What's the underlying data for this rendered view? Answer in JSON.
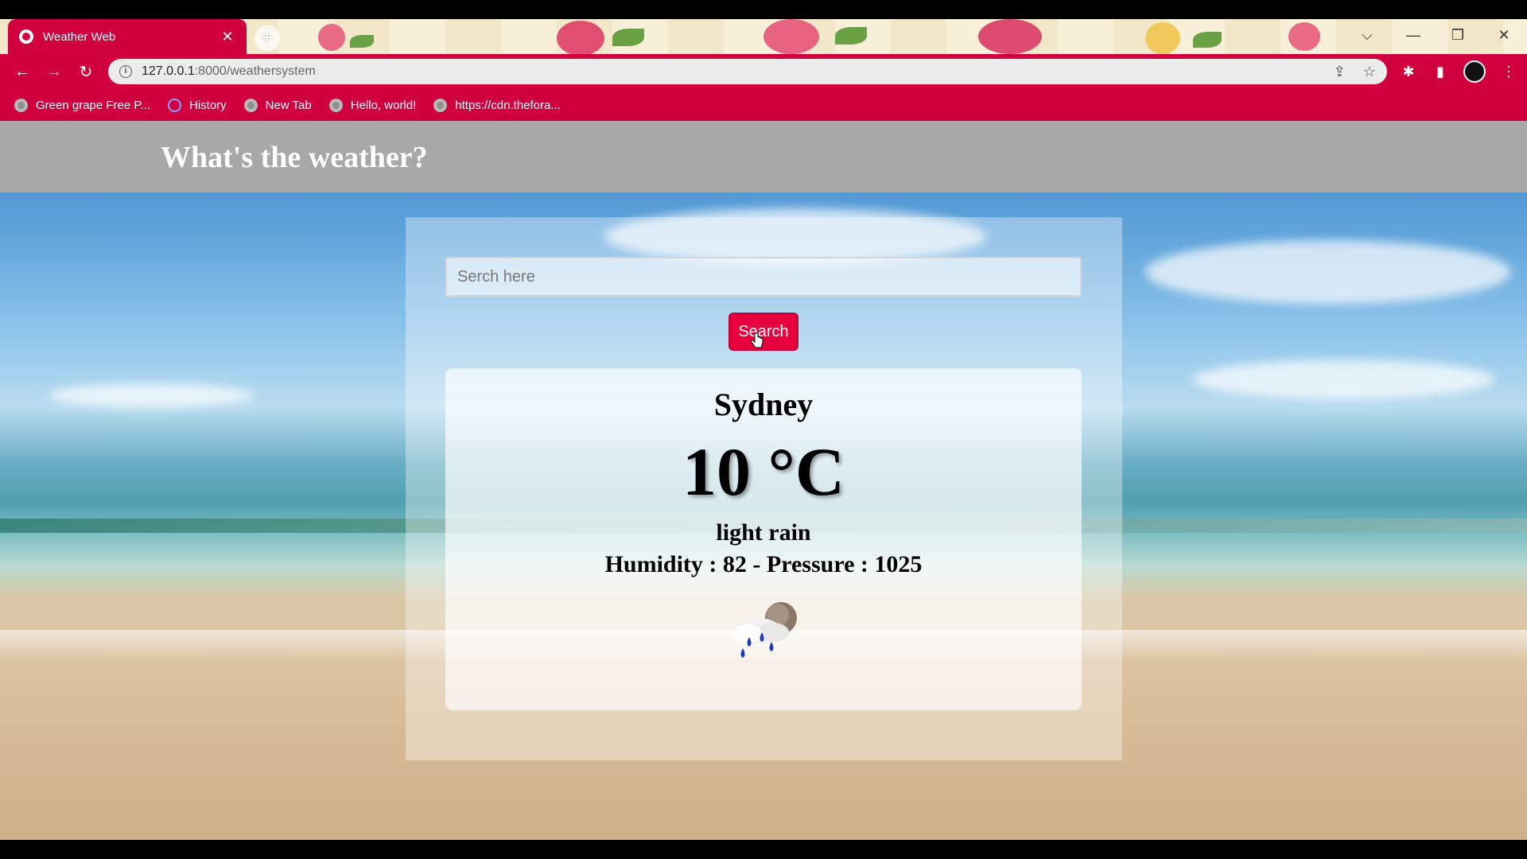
{
  "browser": {
    "tab_title": "Weather Web",
    "tab_close": "✕",
    "new_tab": "+",
    "url_host": "127.0.0.1",
    "url_path": ":8000/weathersystem",
    "bookmarks": [
      {
        "label": "Green grape Free P..."
      },
      {
        "label": "History"
      },
      {
        "label": "New Tab"
      },
      {
        "label": "Hello, world!"
      },
      {
        "label": "https://cdn.thefora..."
      }
    ],
    "accent_color": "#d0003f"
  },
  "header": {
    "title": "What's the weather?"
  },
  "search": {
    "placeholder": "Serch here",
    "button_label": "Search"
  },
  "weather": {
    "city": "Sydney",
    "temperature": "10 °C",
    "description": "light rain",
    "stats": "Humidity : 82 - Pressure : 1025",
    "icon": "light-rain-cloud-icon"
  }
}
